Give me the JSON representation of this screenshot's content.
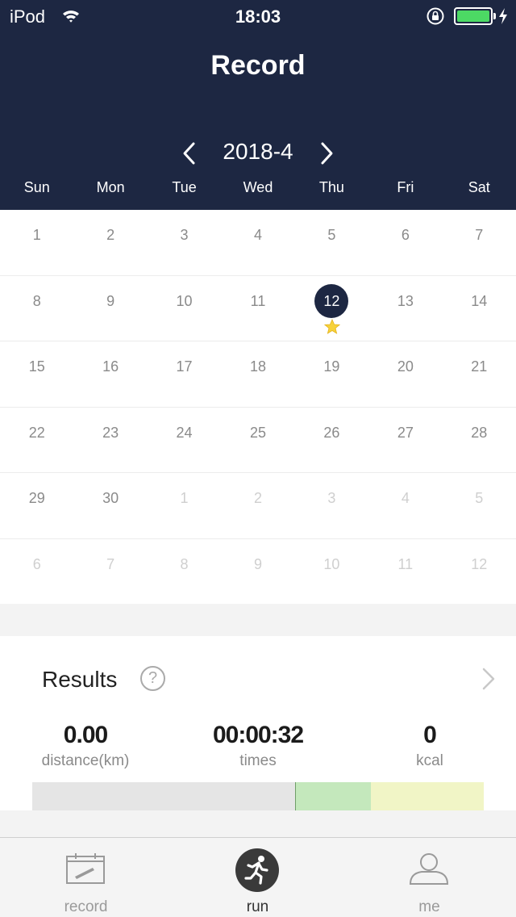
{
  "status_bar": {
    "carrier": "iPod",
    "time": "18:03"
  },
  "header": {
    "title": "Record",
    "month": "2018-4"
  },
  "weekdays": [
    "Sun",
    "Mon",
    "Tue",
    "Wed",
    "Thu",
    "Fri",
    "Sat"
  ],
  "calendar": {
    "rows": [
      [
        "1",
        "2",
        "3",
        "4",
        "5",
        "6",
        "7"
      ],
      [
        "8",
        "9",
        "10",
        "11",
        "12",
        "13",
        "14"
      ],
      [
        "15",
        "16",
        "17",
        "18",
        "19",
        "20",
        "21"
      ],
      [
        "22",
        "23",
        "24",
        "25",
        "26",
        "27",
        "28"
      ],
      [
        "29",
        "30",
        "1",
        "2",
        "3",
        "4",
        "5"
      ],
      [
        "6",
        "7",
        "8",
        "9",
        "10",
        "11",
        "12"
      ]
    ],
    "selected_day": "12",
    "starred_day": "12"
  },
  "results": {
    "title": "Results",
    "help": "?",
    "stats": [
      {
        "value": "0.00",
        "label": "distance(km)"
      },
      {
        "value": "00:00:32",
        "label": "times"
      },
      {
        "value": "0",
        "label": "kcal"
      }
    ],
    "segment_colors": [
      "#e5e5e5",
      "#c4e8bc",
      "#f1f5c6"
    ]
  },
  "tabs": [
    {
      "label": "record",
      "icon": "calendar-icon",
      "active": false
    },
    {
      "label": "run",
      "icon": "runner-icon",
      "active": true
    },
    {
      "label": "me",
      "icon": "person-icon",
      "active": false
    }
  ],
  "colors": {
    "header_bg": "#1d2742",
    "battery": "#4cd964"
  }
}
